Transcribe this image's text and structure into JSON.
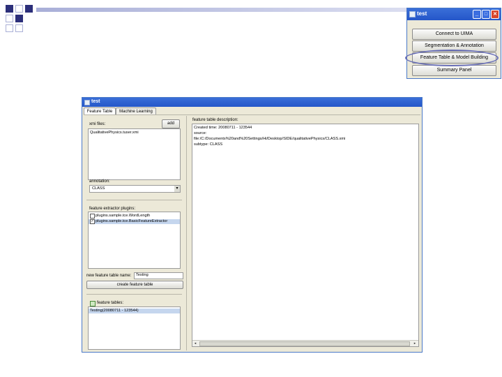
{
  "mini_window": {
    "title": "test",
    "buttons": [
      {
        "label": "Connect to UIMA"
      },
      {
        "label": "Segmentation & Annotation"
      },
      {
        "label": "Feature Table & Model Building"
      },
      {
        "label": "Summary Panel"
      }
    ],
    "highlighted": "Feature Table & Model Building"
  },
  "main_window": {
    "title": "test",
    "tabs": [
      {
        "label": "Feature Table",
        "active": true
      },
      {
        "label": "Machine Learning",
        "active": false
      }
    ],
    "xmi_files": {
      "label": "xmi files:",
      "add_label": "add",
      "items": [
        "QualitativePhysics.tuser.xmi"
      ]
    },
    "annotation": {
      "label": "annotation:",
      "value": "CLASS"
    },
    "feature_extractor_plugins": {
      "label": "feature extractor plugins:",
      "items": [
        {
          "label": "plugins.sample.tce.WordLength",
          "checked": false,
          "selected": false
        },
        {
          "label": "plugins.sample.tce.BasicFeatureExtractor",
          "checked": true,
          "selected": true
        }
      ]
    },
    "new_feature_table": {
      "label": "new feature table name:",
      "value": "Testing",
      "create_label": "create feature table"
    },
    "feature_tables": {
      "label": "feature tables:",
      "items": [
        "Testing(20080711 - 123544)"
      ]
    },
    "description": {
      "label": "feature table description:",
      "lines": [
        "Created time: 20080711 - 123544",
        "source:",
        "    file:/C:/Documents%20and%20Settings/Hi/Desktop/SIDE/qualitativePhysics/CLASS.xmi",
        "subtype: CLASS"
      ]
    }
  },
  "colors": {
    "titlebar": "#2456c9",
    "window_bg": "#ece9d8",
    "highlight": "#6a70b8",
    "selection": "#c5d6ee"
  }
}
